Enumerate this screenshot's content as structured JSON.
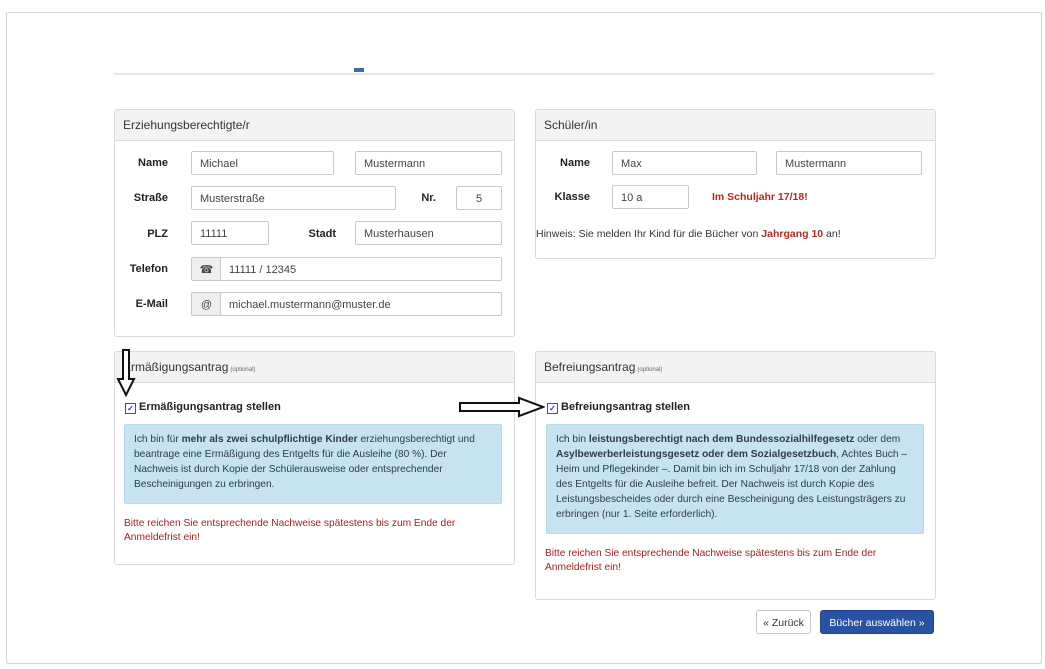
{
  "parent": {
    "title": "Erziehungsberechtigte/r",
    "name_label": "Name",
    "first_name": "Michael",
    "last_name": "Mustermann",
    "street_label": "Straße",
    "street": "Musterstraße",
    "nr_label": "Nr.",
    "nr": "5",
    "plz_label": "PLZ",
    "plz": "11111",
    "city_label": "Stadt",
    "city": "Musterhausen",
    "phone_label": "Telefon",
    "phone_icon": "☎",
    "phone": "11111 / 12345",
    "email_label": "E-Mail",
    "email_icon": "@",
    "email": "michael.mustermann@muster.de"
  },
  "student": {
    "title": "Schüler/in",
    "name_label": "Name",
    "first_name": "Max",
    "last_name": "Mustermann",
    "class_label": "Klasse",
    "class_value": "10 a",
    "school_year": "Im Schuljahr 17/18!",
    "hint_pre": "Hinweis: Sie melden Ihr Kind für die Bücher von ",
    "hint_bold": "Jahrgang 10",
    "hint_post": " an!"
  },
  "reduction": {
    "title": "Ermäßigungsantrag",
    "optional": "(optional)",
    "checkbox_label": "Ermäßigungsantrag stellen",
    "checked": true,
    "info_1": "Ich bin für ",
    "info_bold": "mehr als zwei schulpflichtige Kinder",
    "info_2": " erziehungsberechtigt und beantrage eine Ermäßigung des Entgelts für die Ausleihe (80 %). Der Nachweis ist durch Kopie der Schülerausweise oder entsprechender Bescheinigungen zu erbringen.",
    "note": "Bitte reichen Sie entsprechende Nachweise spätestens bis zum Ende der Anmeldefrist ein!"
  },
  "exemption": {
    "title": "Befreiungsantrag",
    "optional": "(optional)",
    "checkbox_label": "Befreiungsantrag stellen",
    "checked": true,
    "info_1": "Ich bin ",
    "info_bold_1": "leistungsberechtigt nach dem Bundessozialhilfegesetz",
    "info_2": " oder dem ",
    "info_bold_2": "Asylbewerberleistungsgesetz oder dem Sozialgesetzbuch",
    "info_3": ", Achtes Buch – Heim und Pflegekinder –. Damit bin ich im Schuljahr 17/18 von der Zahlung des Entgelts für die Ausleihe befreit. Der Nachweis ist durch Kopie des Leistungsbescheides oder durch eine Bescheinigung des Leistungsträgers zu erbringen (nur 1. Seite erforderlich).",
    "note": "Bitte reichen Sie entsprechende Nachweise spätestens bis zum Ende der Anmeldefrist ein!"
  },
  "nav": {
    "back": "« Zurück",
    "next": "Bücher auswählen »"
  },
  "icons": {
    "down_arrow": "down-arrow-annotation",
    "right_arrow": "right-arrow-annotation"
  }
}
